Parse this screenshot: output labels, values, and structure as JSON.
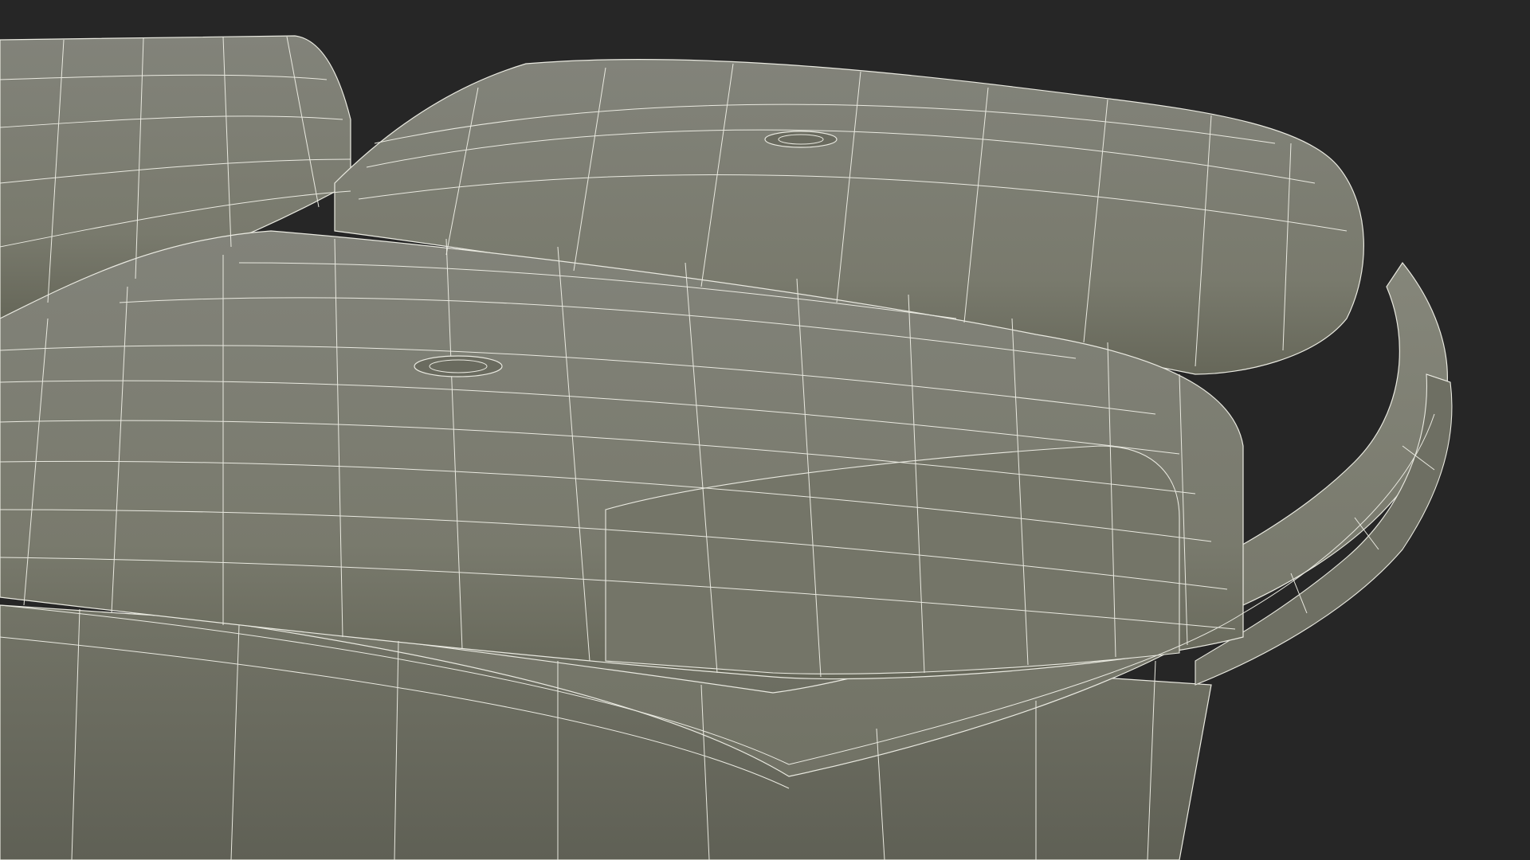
{
  "scene": {
    "background_color": "#262626",
    "mesh_fill_color": "#797a6d",
    "mesh_shadow_color": "#5b5c52",
    "mesh_highlight_color": "#8a8b7e",
    "wireframe_color": "#e9e9e0"
  }
}
